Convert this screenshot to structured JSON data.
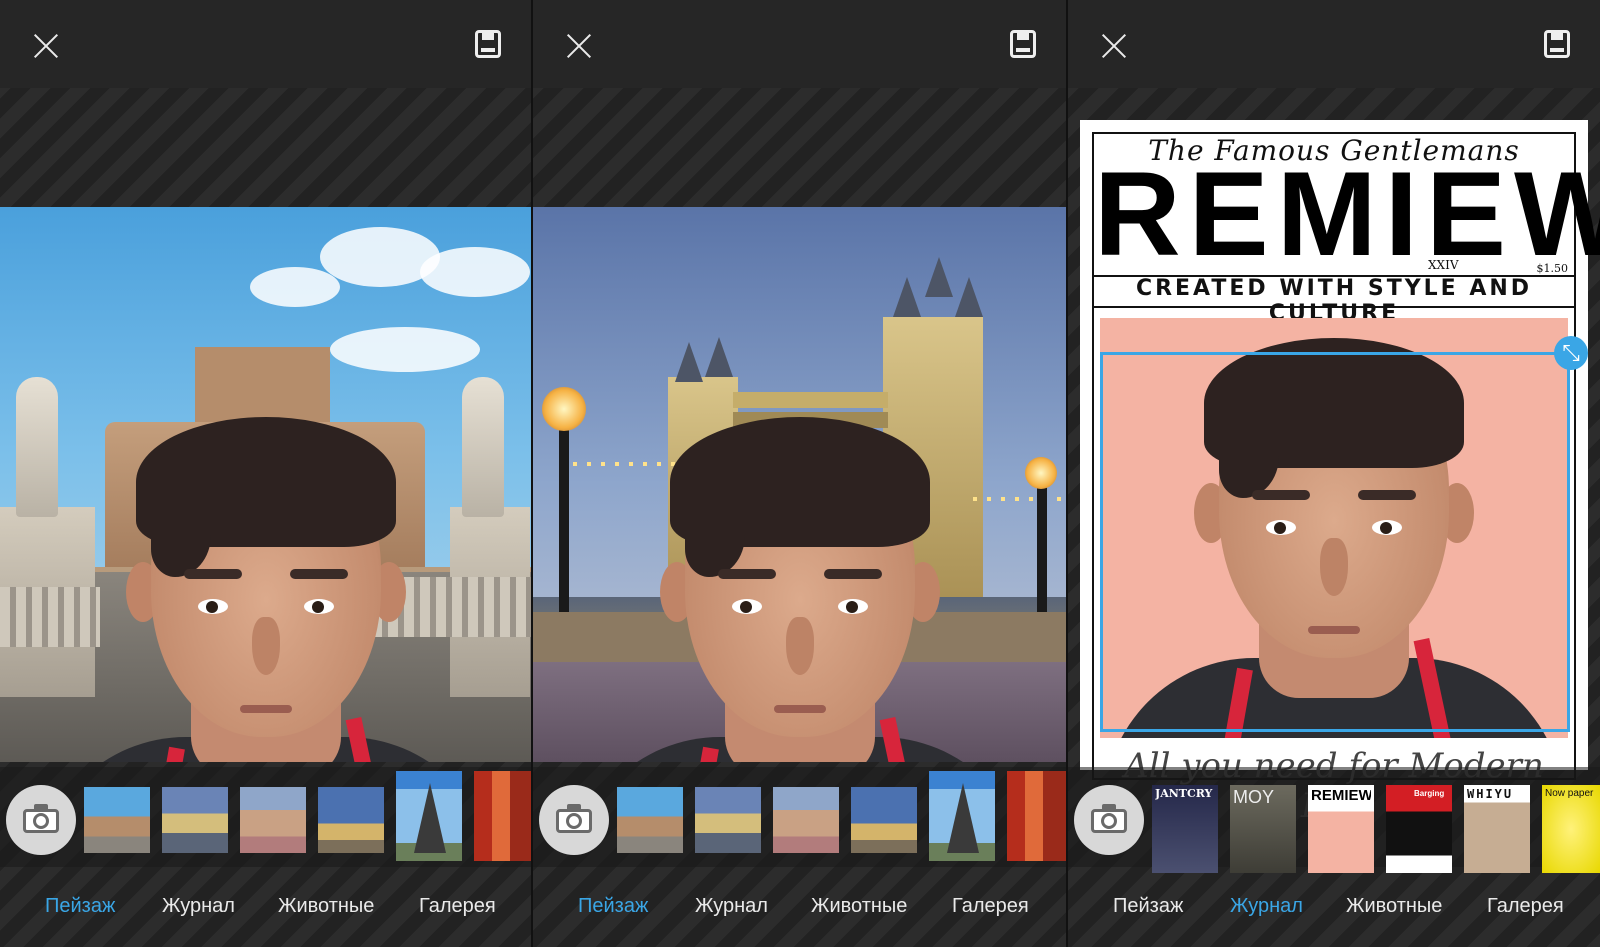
{
  "accent_color": "#3aa6e6",
  "screens": [
    {
      "id": "screen-1",
      "background": "Rome",
      "active_tab": 0,
      "thumbnails": [
        "Castel Sant'Angelo",
        "Tower Bridge",
        "Palace",
        "Louvre",
        "Eiffel Tower",
        "Torii"
      ]
    },
    {
      "id": "screen-2",
      "background": "London",
      "active_tab": 0,
      "thumbnails": [
        "Castel Sant'Angelo",
        "Tower Bridge",
        "Palace",
        "Louvre",
        "Eiffel Tower",
        "Torii"
      ]
    },
    {
      "id": "screen-3",
      "active_tab": 1,
      "magazine": {
        "subtitle": "The Famous Gentlemans",
        "title": "REMIEW",
        "issue": "XXIV",
        "price": "$1.50",
        "tagline": "CREATED WITH STYLE AND CULTURE",
        "footer": "All you need for Modern Life"
      },
      "covers": [
        "JANTCRY",
        "MOY",
        "REMIEW",
        "Barging",
        "WHIYU",
        "Now paper"
      ]
    }
  ],
  "tabs": [
    "Пейзаж",
    "Журнал",
    "Животные",
    "Галерея"
  ],
  "icons": {
    "close": "close-icon",
    "save": "save-icon",
    "camera": "camera-icon",
    "resize": "resize-icon"
  }
}
